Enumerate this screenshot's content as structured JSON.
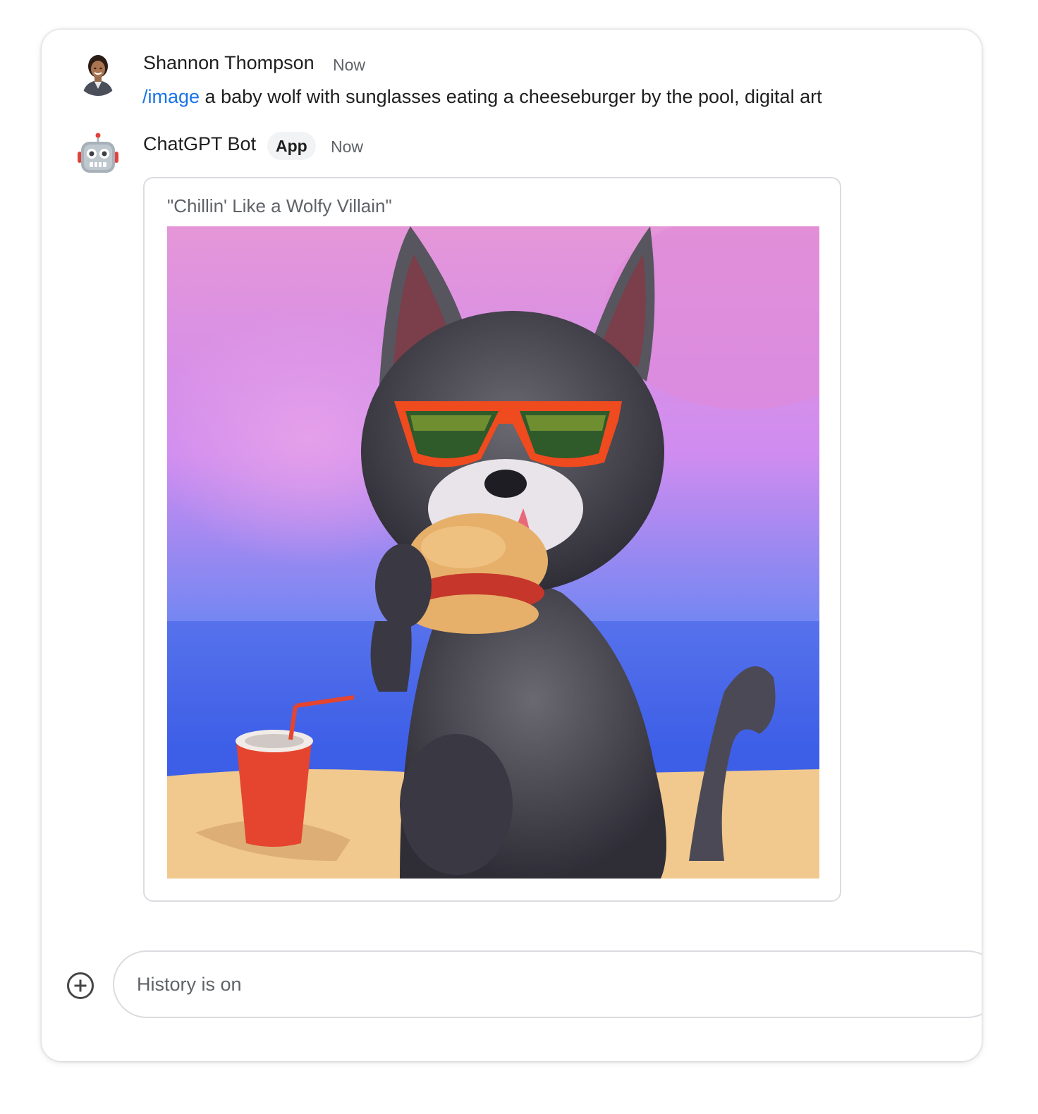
{
  "messages": [
    {
      "sender": "Shannon Thompson",
      "time": "Now",
      "command": "/image",
      "text": " a baby wolf with sunglasses eating a cheeseburger by the pool, digital art",
      "avatar_icon": "user-photo-avatar"
    },
    {
      "sender": "ChatGPT Bot",
      "badge": "App",
      "time": "Now",
      "avatar_icon": "robot-icon",
      "card": {
        "title": "\"Chillin' Like a Wolfy Villain\"",
        "image_subject": "wolf-with-sunglasses-eating-cheeseburger-image"
      }
    }
  ],
  "composer": {
    "placeholder": "History is on",
    "add_icon": "add-circle-icon"
  },
  "colors": {
    "link": "#1a73e8",
    "text": "#1f1f1f",
    "secondary": "#5f6368",
    "border": "#dadce0"
  }
}
